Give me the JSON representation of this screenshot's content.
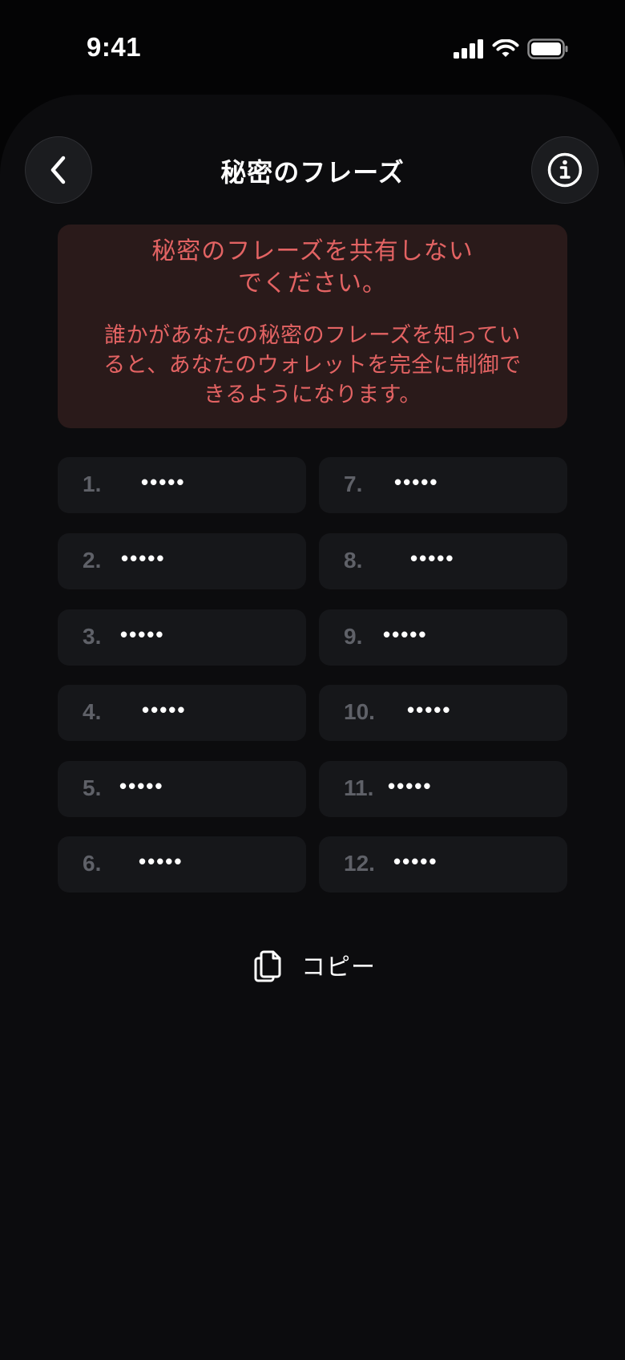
{
  "status_bar": {
    "time": "9:41"
  },
  "nav": {
    "title": "秘密のフレーズ"
  },
  "warning": {
    "title": "秘密のフレーズを共有しない\nでください。",
    "body": "誰かがあなたの秘密のフレーズを知ってい\nると、あなたのウォレットを完全に制御で\nきるようになります。"
  },
  "words": [
    {
      "num": "1.",
      "value": "•••••"
    },
    {
      "num": "7.",
      "value": "•••••"
    },
    {
      "num": "2.",
      "value": "•••••"
    },
    {
      "num": "8.",
      "value": "•••••"
    },
    {
      "num": "3.",
      "value": "•••••"
    },
    {
      "num": "9.",
      "value": "•••••"
    },
    {
      "num": "4.",
      "value": "•••••"
    },
    {
      "num": "10.",
      "value": "•••••"
    },
    {
      "num": "5.",
      "value": "•••••"
    },
    {
      "num": "11.",
      "value": "•••••"
    },
    {
      "num": "6.",
      "value": "•••••"
    },
    {
      "num": "12.",
      "value": "•••••"
    }
  ],
  "copy": {
    "label": "コピー"
  },
  "colors": {
    "warning_text": "#e36363",
    "warning_bg": "#2a1a1a",
    "cell_bg": "#16171a"
  },
  "icons": {
    "back": "chevron-left-icon",
    "info": "info-icon",
    "copy": "copy-icon",
    "signal": "signal-icon",
    "wifi": "wifi-icon",
    "battery": "battery-icon"
  }
}
